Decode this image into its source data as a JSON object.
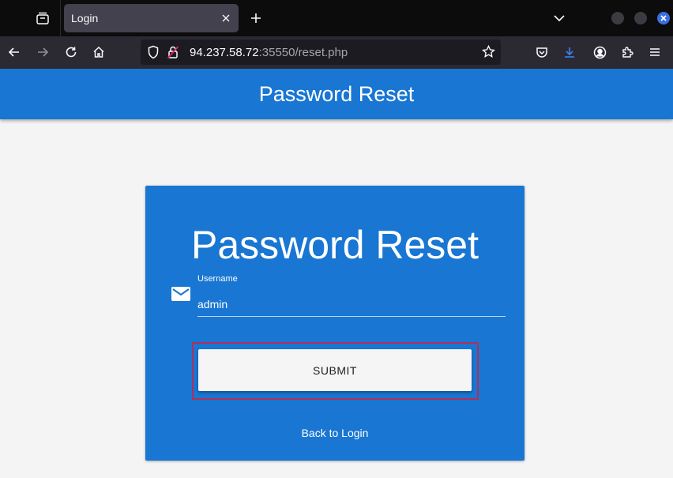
{
  "browser": {
    "tab": {
      "title": "Login"
    },
    "url": {
      "host": "94.237.58.72",
      "rest": ":35550/reset.php"
    },
    "icons": {
      "tabs": "tabs-overview-icon",
      "close_tab": "close-icon",
      "new_tab": "plus-icon",
      "list_all_tabs": "chevron-down-icon",
      "back": "arrow-left-icon",
      "forward": "arrow-right-icon",
      "reload": "reload-icon",
      "home": "home-icon",
      "tracking": "shield-icon",
      "insecure": "insecure-lock-icon",
      "bookmark": "star-icon",
      "pocket": "pocket-icon",
      "downloads": "download-icon",
      "account": "account-icon",
      "extensions": "puzzle-icon",
      "menu": "hamburger-menu-icon"
    }
  },
  "page": {
    "header_title": "Password Reset",
    "card": {
      "title": "Password Reset",
      "username": {
        "label": "Username",
        "value": "admin"
      },
      "submit_label": "SUBMIT",
      "back_link": "Back to Login"
    }
  },
  "colors": {
    "primary": "#1976d2",
    "highlight": "#b0305a",
    "download_accent": "#3b82f6"
  }
}
